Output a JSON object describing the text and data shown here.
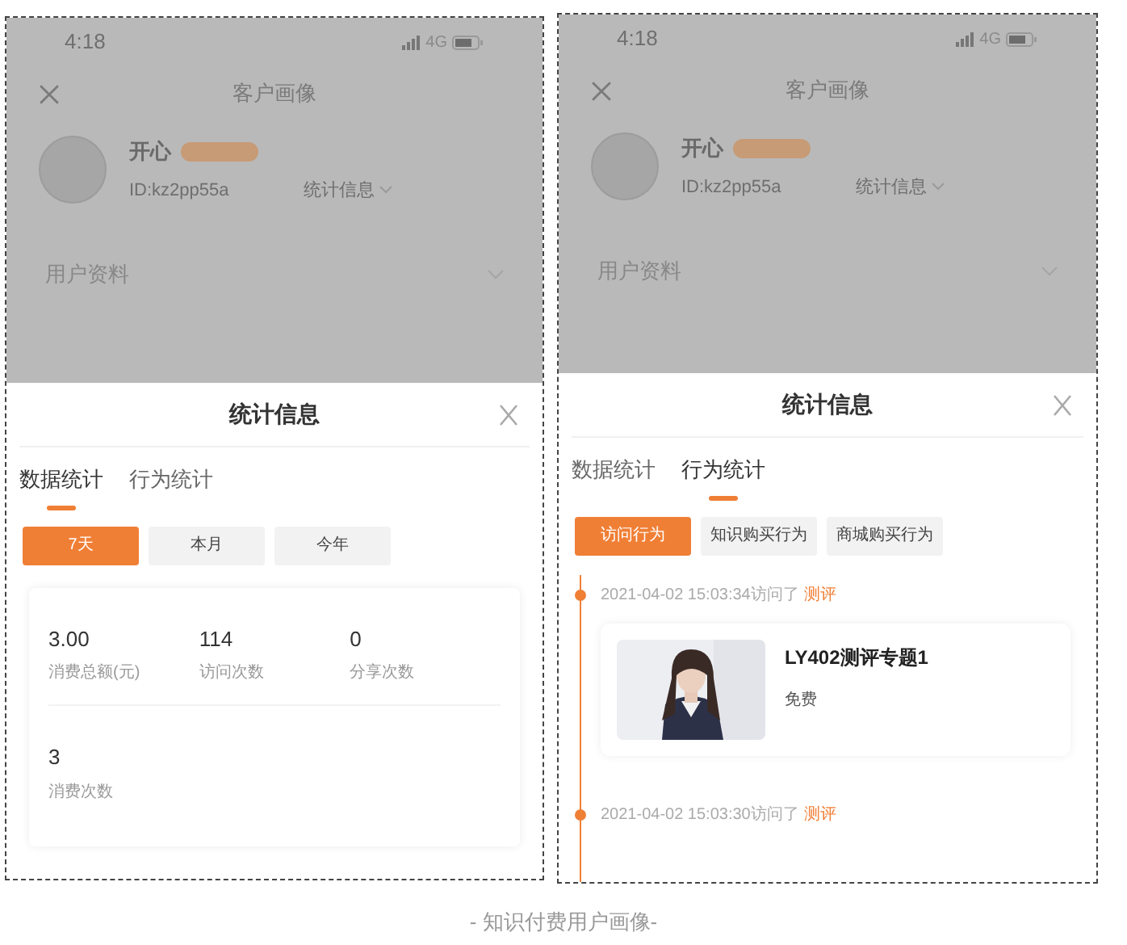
{
  "screens": [
    {
      "status_bar": {
        "time": "4:18",
        "network": "4G"
      },
      "header": {
        "title": "客户画像"
      },
      "profile": {
        "name": "开心",
        "id": "ID:kz2pp55a",
        "stats_link": "统计信息"
      },
      "section": {
        "title": "用户资料"
      },
      "sheet": {
        "title": "统计信息",
        "kind": "stats",
        "tabs": [
          {
            "label": "数据统计",
            "selected": true
          },
          {
            "label": "行为统计",
            "selected": false
          }
        ],
        "filters": [
          {
            "label": "7天",
            "selected": true
          },
          {
            "label": "本月",
            "selected": false
          },
          {
            "label": "今年",
            "selected": false
          }
        ],
        "stats": [
          {
            "value": "3.00",
            "label": "消费总额(元)"
          },
          {
            "value": "114",
            "label": "访问次数"
          },
          {
            "value": "0",
            "label": "分享次数"
          },
          {
            "value": "3",
            "label": "消费次数"
          }
        ]
      }
    },
    {
      "status_bar": {
        "time": "4:18",
        "network": "4G"
      },
      "header": {
        "title": "客户画像"
      },
      "profile": {
        "name": "开心",
        "id": "ID:kz2pp55a",
        "stats_link": "统计信息"
      },
      "section": {
        "title": "用户资料"
      },
      "sheet": {
        "title": "统计信息",
        "kind": "timeline",
        "tabs": [
          {
            "label": "数据统计",
            "selected": false
          },
          {
            "label": "行为统计",
            "selected": true
          }
        ],
        "filters": [
          {
            "label": "访问行为",
            "selected": true
          },
          {
            "label": "知识购买行为",
            "selected": false
          },
          {
            "label": "商城购买行为",
            "selected": false
          }
        ],
        "events": [
          {
            "time": "2021-04-02 15:03:34访问了",
            "link": "测评",
            "item": {
              "kind": "picture",
              "title": "LY402测评专题1",
              "price": "免费"
            }
          },
          {
            "time": "2021-04-02 15:03:30访问了",
            "link": "测评"
          }
        ]
      }
    }
  ],
  "caption": "- 知识付费用户画像-"
}
